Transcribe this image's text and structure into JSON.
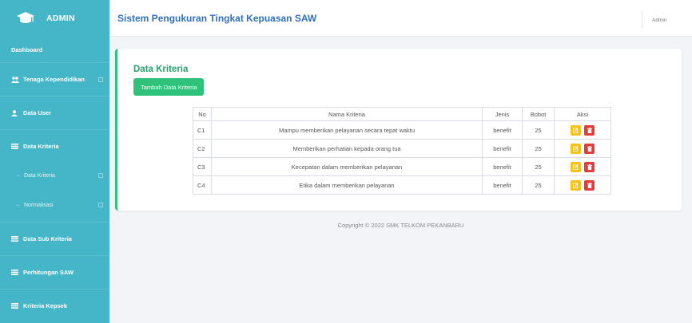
{
  "brand": {
    "title": "ADMIN"
  },
  "sidebar": {
    "items": [
      {
        "label": "Dashboard"
      },
      {
        "label": "Tenaga Kependidikan"
      },
      {
        "label": "Data User"
      },
      {
        "label": "Data Kriteria"
      },
      {
        "label": "Data Kriteria"
      },
      {
        "label": "Normalisasi"
      },
      {
        "label": "Data Sub Kriteria"
      },
      {
        "label": "Perhitungan SAW"
      },
      {
        "label": "Kriteria Kepsek"
      }
    ]
  },
  "header": {
    "title": "Sistem Pengukuran Tingkat Kepuasan SAW",
    "user": "Admin"
  },
  "card": {
    "title": "Data Kriteria",
    "add_button": "Tambah Data Kriteria"
  },
  "table": {
    "headers": [
      "No",
      "Nama Kriteria",
      "Jenis",
      "Bobot",
      "Aksi"
    ],
    "rows": [
      {
        "no": "C1",
        "nama": "Mampu memberikan pelayanan secara tepat waktu",
        "jenis": "benefit",
        "bobot": "25"
      },
      {
        "no": "C2",
        "nama": "Memberikan perhatian kepada orang tua",
        "jenis": "benefit",
        "bobot": "25"
      },
      {
        "no": "C3",
        "nama": "Kecepatan dalam memberikan pelayanan",
        "jenis": "benefit",
        "bobot": "25"
      },
      {
        "no": "C4",
        "nama": "Etika dalam memberikan pelayanan",
        "jenis": "benefit",
        "bobot": "25"
      }
    ]
  },
  "footer": {
    "text": "Copyright © 2022 SMK TELKOM PEKANBARU"
  },
  "colors": {
    "sidebar": "#45b6c7",
    "accent": "#2fc27a",
    "title": "#2f6fbc",
    "edit": "#f6c21c",
    "delete": "#e23c3c"
  },
  "icons": {
    "brand": "graduation-cap-icon",
    "edit": "edit-icon",
    "delete": "trash-icon"
  }
}
